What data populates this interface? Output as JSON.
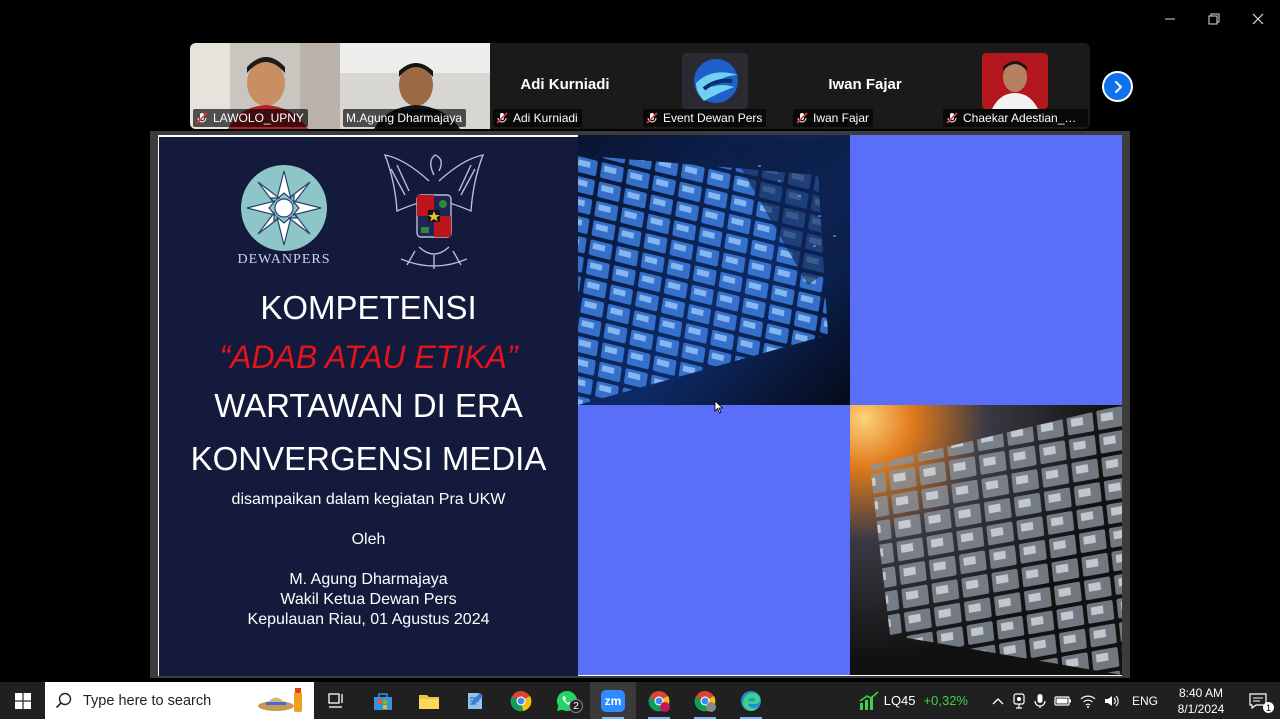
{
  "window": {
    "controls": {
      "minimize": "minimize",
      "restore": "restore",
      "close": "close"
    }
  },
  "gallery": {
    "participants": [
      {
        "name": "LAWOLO_UPNY",
        "muted": true,
        "video": true
      },
      {
        "name": "M.Agung Dharmajaya",
        "muted": false,
        "video": true,
        "active": true
      },
      {
        "name": "Adi Kurniadi",
        "muted": true,
        "video": false
      },
      {
        "name": "Event Dewan Pers",
        "muted": true,
        "video": false,
        "avatar": "kominfo-logo"
      },
      {
        "name": "Iwan Fajar",
        "muted": true,
        "video": false
      },
      {
        "name": "Chaekar Adestian_UP...",
        "muted": true,
        "video": false,
        "avatar": "photo"
      }
    ],
    "next_icon": "chevron-right-icon"
  },
  "slide": {
    "logo_text": "DEWANPERS",
    "title_1": "KOMPETENSI",
    "title_2": "“ADAB ATAU ETIKA”",
    "title_3": "WARTAWAN DI ERA",
    "title_4": "KONVERGENSI MEDIA",
    "subtitle": "disampaikan dalam kegiatan Pra UKW",
    "by": "Oleh",
    "presenter": "M. Agung Dharmajaya",
    "role": "Wakil Ketua Dewan Pers",
    "place_date": "Kepulauan Riau, 01 Agustus 2024",
    "colors": {
      "navy": "#131a3b",
      "red": "#e3141c",
      "blue_panel": "#5a6ff8"
    }
  },
  "taskbar": {
    "search_placeholder": "Type here to search",
    "apps": [
      "task-view",
      "microsoft-store",
      "file-explorer",
      "notepad",
      "chrome",
      "whatsapp",
      "zoom",
      "chrome-profile-1",
      "chrome-profile-2",
      "edge"
    ],
    "whatsapp_badge": "2",
    "zoom_label": "zm",
    "stock_name": "LQ45",
    "stock_change": "+0,32%",
    "language": "ENG",
    "time": "8:40 AM",
    "date": "8/1/2024",
    "notification_count": "1"
  }
}
